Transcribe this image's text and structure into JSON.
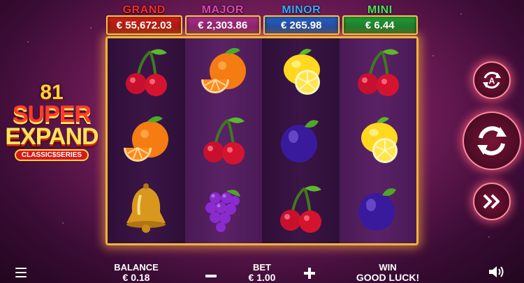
{
  "jackpots": [
    {
      "name": "GRAND",
      "amount": "€ 55,672.03"
    },
    {
      "name": "MAJOR",
      "amount": "€ 2,303.86"
    },
    {
      "name": "MINOR",
      "amount": "€ 265.98"
    },
    {
      "name": "MINI",
      "amount": "€ 6.44"
    }
  ],
  "logo": {
    "line1": "81",
    "line2": "SUPER",
    "line3": "EXPAND",
    "series": "CLASSIC$SERIES"
  },
  "reels": [
    [
      "cherry",
      "orange",
      "lemon",
      "cherry"
    ],
    [
      "orange",
      "cherry",
      "plum",
      "lemon"
    ],
    [
      "bell",
      "grapes",
      "cherry",
      "plum"
    ]
  ],
  "buttons": {
    "autoplay_icon": "autoplay-icon",
    "spin_icon": "spin-icon",
    "turbo_icon": "fast-forward-icon",
    "autoplay_letter": "A"
  },
  "bottom_bar": {
    "balance_label": "BALANCE",
    "balance_value": "€ 0.18",
    "bet_label": "BET",
    "bet_value": "€ 1.00",
    "win_label": "WIN",
    "win_value": "GOOD LUCK!"
  },
  "colors": {
    "grand": "#ff2a2a",
    "major": "#e046b8",
    "minor": "#3ea6ff",
    "mini": "#49e25a",
    "frame": "#f0b43a"
  }
}
